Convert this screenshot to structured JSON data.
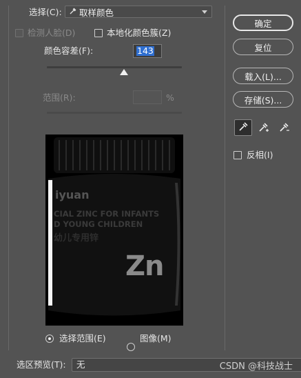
{
  "dialog": {
    "select_label": "选择(C):",
    "select_value": "取样颜色",
    "detect_faces_label": "检测人脸(D)",
    "localized_label": "本地化颜色簇(Z)",
    "fuzziness_label": "颜色容差(F):",
    "fuzziness_value": "143",
    "fuzziness_percent": 0.57,
    "range_label": "范围(R):",
    "range_unit": "%",
    "preview": {
      "brand": "iyuan",
      "text_line1": "CIAL ZINC FOR INFANTS",
      "text_line2": "D YOUNG CHILDREN",
      "cn_text": "幼儿专用锌",
      "zn": "Zn"
    },
    "radio_selection_label": "选择范围(E)",
    "radio_image_label": "图像(M)",
    "selection_preview_label": "选区预览(T):",
    "selection_preview_value": "无"
  },
  "buttons": {
    "ok": "确定",
    "reset": "复位",
    "load": "载入(L)...",
    "save": "存储(S)..."
  },
  "invert_label": "反相(I)",
  "watermark": "CSDN @科技战士"
}
